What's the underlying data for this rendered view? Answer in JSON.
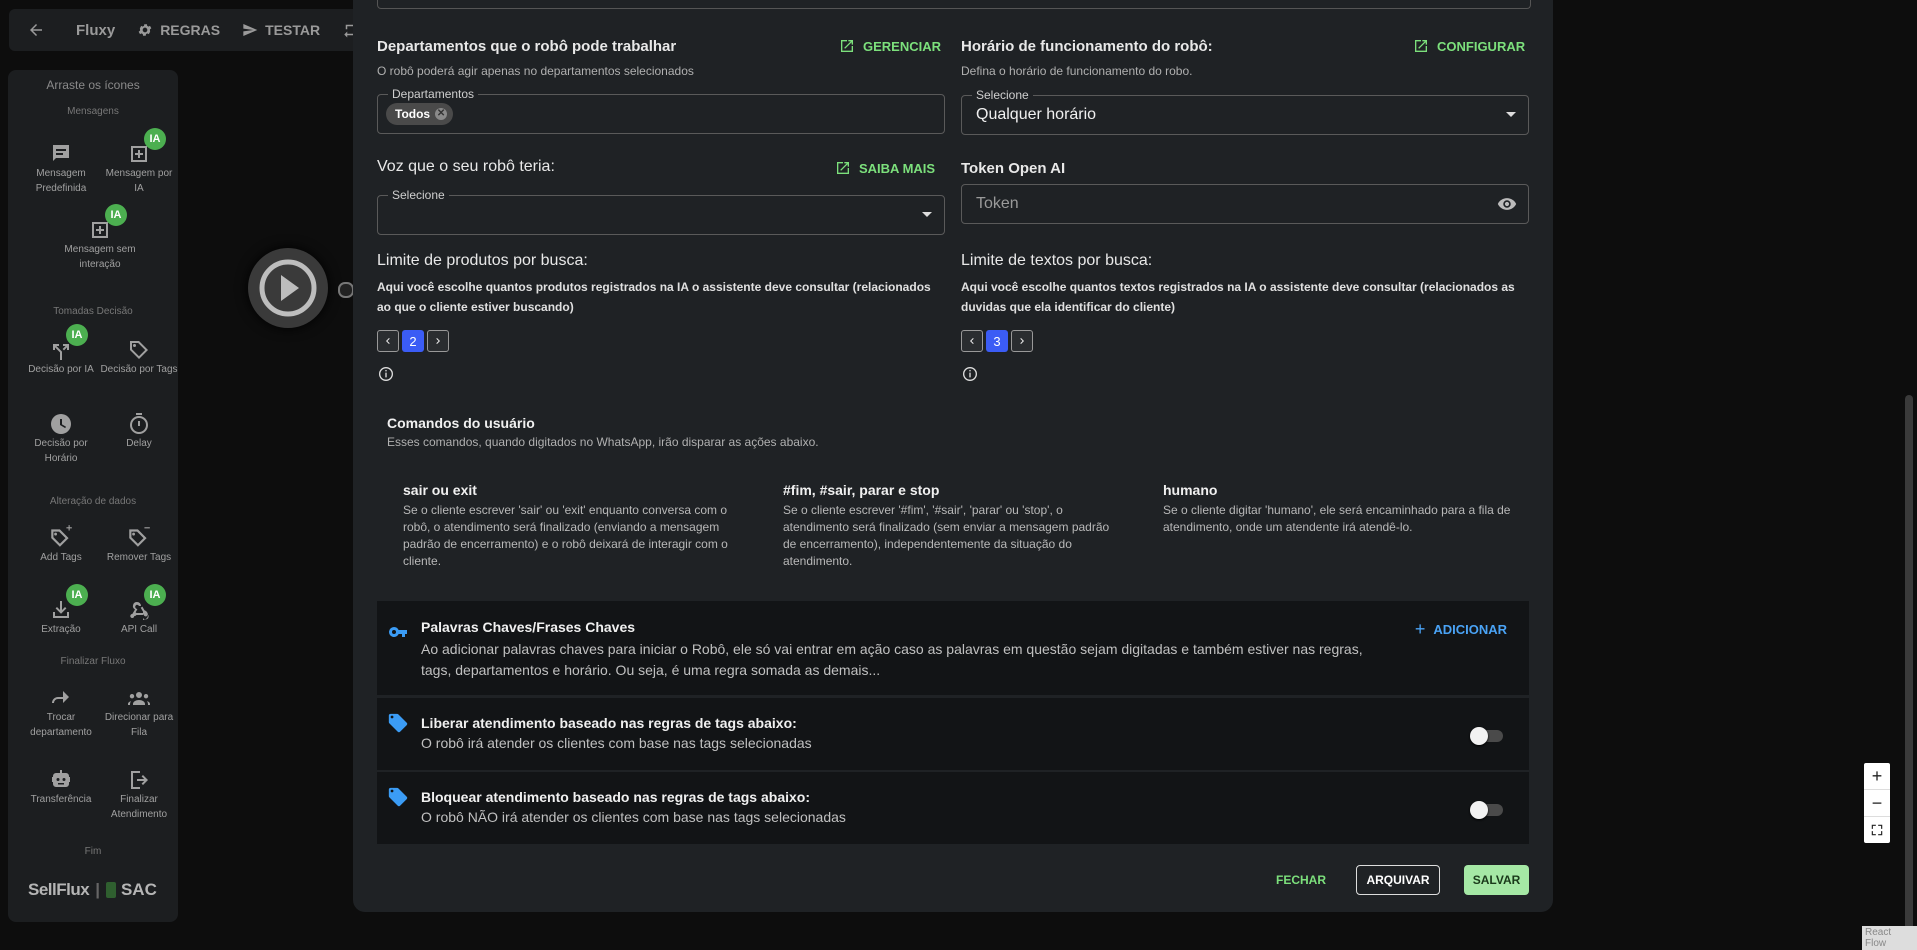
{
  "topbar": {
    "app_name": "Fluxy",
    "rules_label": "REGRAS",
    "test_label": "TESTAR"
  },
  "sidebar": {
    "header": "Arraste os ícones",
    "sections": {
      "messages": "Mensagens",
      "decisions": "Tomadas Decisão",
      "data": "Alteração de dados",
      "finish": "Finalizar Fluxo",
      "end": "Fim"
    },
    "ia_badge": "IA",
    "items": {
      "predefined": "Mensagem Predefinida",
      "ai_message": "Mensagem por IA",
      "no_interaction": "Mensagem sem interação",
      "ai_decision": "Decisão por IA",
      "tag_decision": "Decisão por Tags",
      "time_decision": "Decisão por Horário",
      "delay": "Delay",
      "add_tags": "Add Tags",
      "remove_tags": "Remover Tags",
      "extraction": "Extração",
      "api_call": "API Call",
      "switch_dept": "Trocar departamento",
      "queue": "Direcionar para Fila",
      "transfer": "Transferência",
      "finish_service": "Finalizar Atendimento"
    },
    "brand": {
      "sellflux": "SellFlux",
      "sac": "SAC"
    }
  },
  "modal": {
    "departments": {
      "title": "Departamentos que o robô pode trabalhar",
      "link": "GERENCIAR",
      "subtitle": "O robô poderá agir apenas no departamentos selecionados",
      "field_label": "Departamentos",
      "chip": "Todos"
    },
    "schedule": {
      "title": "Horário de funcionamento do robô:",
      "link": "CONFIGURAR",
      "subtitle": "Defina o horário de funcionamento do robo.",
      "field_label": "Selecione",
      "value": "Qualquer horário"
    },
    "voice": {
      "title": "Voz que o seu robô teria:",
      "link": "SAIBA MAIS",
      "field_label": "Selecione"
    },
    "token": {
      "title": "Token Open AI",
      "placeholder": "Token"
    },
    "product_limit": {
      "title": "Limite de produtos por busca:",
      "desc": "Aqui você escolhe quantos produtos registrados na IA o assistente deve consultar (relacionados ao que o cliente estiver buscando)",
      "value": "2"
    },
    "text_limit": {
      "title": "Limite de textos por busca:",
      "desc": "Aqui você escolhe quantos textos registrados na IA o assistente deve consultar (relacionados as duvidas que ela identificar do cliente)",
      "value": "3"
    },
    "commands": {
      "title": "Comandos do usuário",
      "subtitle": "Esses comandos, quando digitados no WhatsApp, irão disparar as ações abaixo.",
      "items": [
        {
          "name": "sair ou exit",
          "desc": "Se o cliente escrever 'sair' ou 'exit' enquanto conversa com o robô, o atendimento será finalizado (enviando a mensagem padrão de encerramento) e o robô deixará de interagir com o cliente."
        },
        {
          "name": "#fim, #sair, parar e stop",
          "desc": "Se o cliente escrever '#fim', '#sair', 'parar' ou 'stop', o atendimento será finalizado (sem enviar a mensagem padrão de encerramento), independentemente da situação do atendimento."
        },
        {
          "name": "humano",
          "desc": "Se o cliente digitar 'humano', ele será encaminhado para a fila de atendimento, onde um atendente irá atendê-lo."
        }
      ]
    },
    "keywords": {
      "title": "Palavras Chaves/Frases Chaves",
      "desc": "Ao adicionar palavras chaves para iniciar o Robô, ele só vai entrar em ação caso as palavras em questão sejam digitadas e também estiver nas regras, tags, departamentos e horário. Ou seja, é uma regra somada as demais...",
      "add": "ADICIONAR"
    },
    "allow_tags": {
      "title": "Liberar atendimento baseado nas regras de tags abaixo:",
      "desc": "O robô irá atender os clientes com base nas tags selecionadas"
    },
    "block_tags": {
      "title": "Bloquear atendimento baseado nas regras de tags abaixo:",
      "desc": "O robô NÃO irá atender os clientes com base nas tags selecionadas"
    },
    "footer": {
      "close": "FECHAR",
      "archive": "ARQUIVAR",
      "save": "SALVAR"
    }
  },
  "zoom": {
    "plus": "+",
    "minus": "−"
  },
  "react_flow_label": "React Flow"
}
